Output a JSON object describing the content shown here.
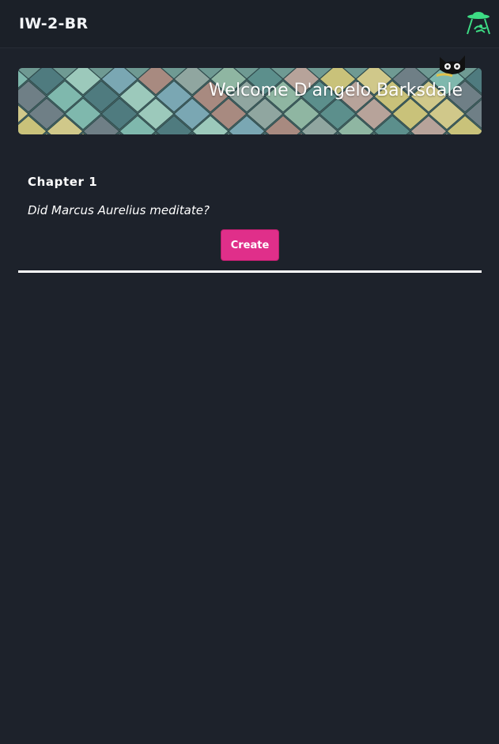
{
  "app": {
    "brand": "IW-2-BR",
    "logo_icon": "ufo-abduction-icon",
    "accent_color": "#3ddc84"
  },
  "banner": {
    "welcome_text": "Welcome D'angelo Barksdale",
    "avatar_icon": "black-cat-icon"
  },
  "chapter": {
    "title": "Chapter 1",
    "question": "Did Marcus Aurelius meditate?",
    "create_label": "Create",
    "create_color": "#e02f8a"
  }
}
